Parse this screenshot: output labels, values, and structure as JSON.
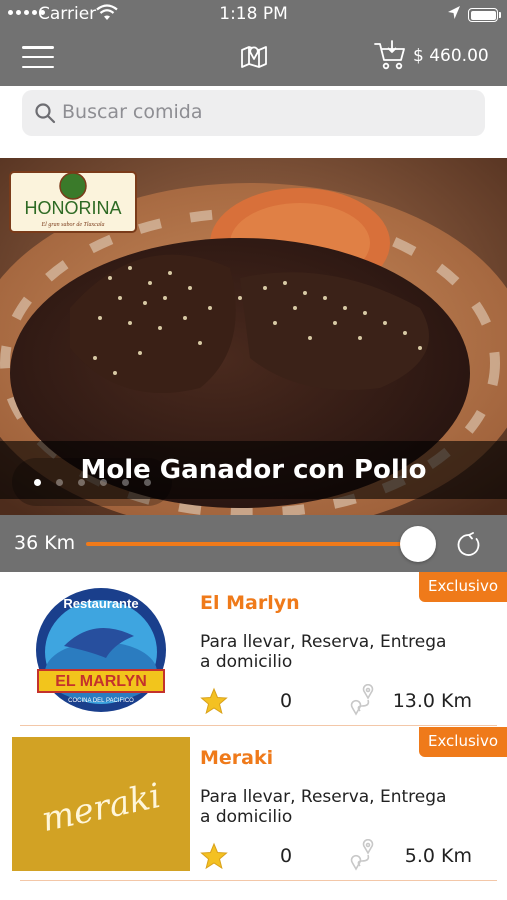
{
  "status": {
    "carrier": "Carrier",
    "time": "1:18 PM"
  },
  "nav": {
    "cart_total": "$ 460.00"
  },
  "search": {
    "placeholder": "Buscar comida"
  },
  "banner": {
    "restaurant_logo_text": "HONORINA",
    "restaurant_logo_tagline": "El gran sabor de Tlaxcala",
    "caption": "Mole Ganador con Pollo",
    "pages": 6,
    "active_page": 1
  },
  "filter": {
    "distance_label": "36 Km",
    "slider_fraction": 0.95
  },
  "restaurants": [
    {
      "badge": "Exclusivo",
      "name": "El Marlyn",
      "services": "Para llevar, Reserva, Entrega a domicilio",
      "rating": "0",
      "distance": "13.0 Km",
      "logo_top": "Restaurante",
      "logo_name": "EL MARLYN",
      "logo_sub": "COCINA DEL PACIFICO"
    },
    {
      "badge": "Exclusivo",
      "name": "Meraki",
      "services": "Para llevar, Reserva, Entrega a domicilio",
      "rating": "0",
      "distance": "5.0 Km",
      "logo_name": "meraki"
    }
  ],
  "colors": {
    "accent": "#ef7a1a",
    "bar_gray": "#727272",
    "caption_text": "#ffffff"
  }
}
